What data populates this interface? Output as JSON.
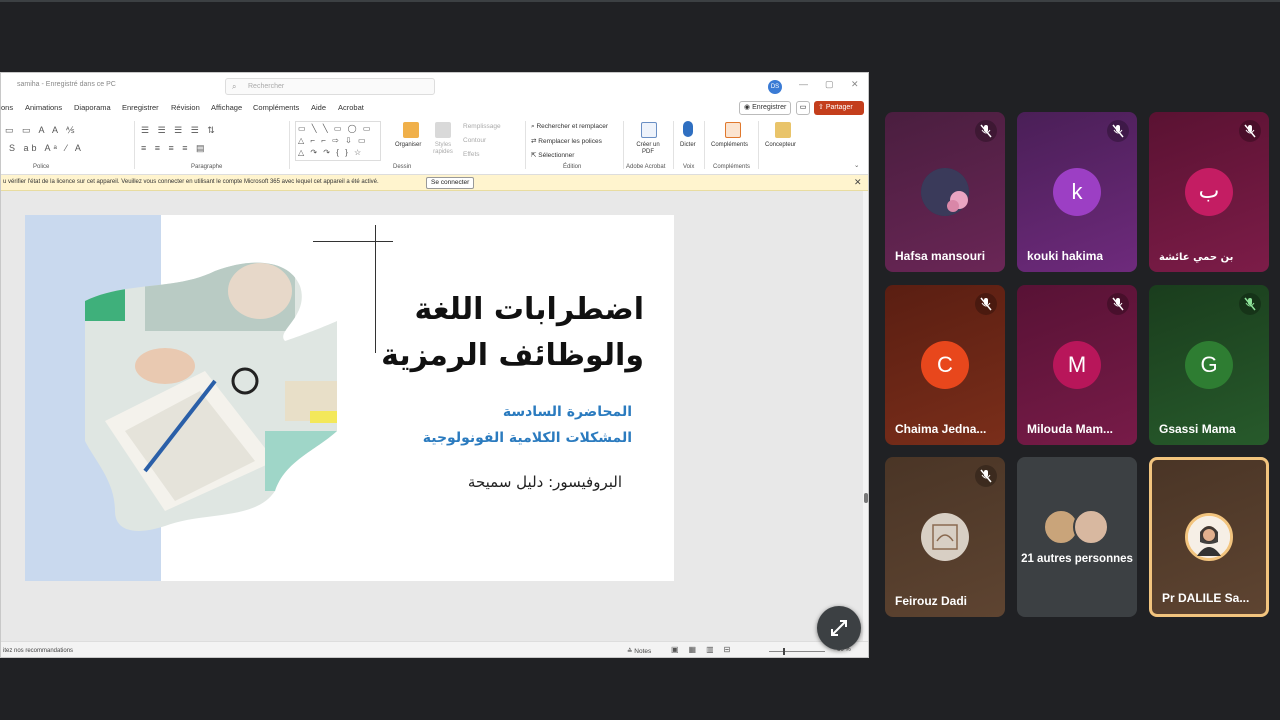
{
  "window": {
    "doc_title": "samiha - Enregistré dans ce PC",
    "search_placeholder": "Rechercher",
    "avatar_initials": "DS",
    "minimize": "—",
    "maximize": "▢",
    "close": "✕"
  },
  "menu": {
    "items": [
      "ons",
      "Animations",
      "Diaporama",
      "Enregistrer",
      "Révision",
      "Affichage",
      "Compléments",
      "Aide",
      "Acrobat"
    ],
    "save_label": "Enregistrer",
    "share_label": "Partager"
  },
  "ribbon": {
    "groups": {
      "police": "Police",
      "paragraphe": "Paragraphe",
      "dessin": "Dessin",
      "edition": "Édition",
      "adobe": "Adobe Acrobat",
      "voix": "Voix",
      "complements": "Compléments"
    },
    "tools": {
      "organiser": "Organiser",
      "styles": "Styles rapides",
      "remplissage": "Remplissage",
      "contour": "Contour",
      "effets": "Effets",
      "rechercher": "Rechercher et remplacer",
      "remplacer_polices": "Remplacer les polices",
      "selectionner": "Sélectionner",
      "creer_pdf": "Créer un PDF",
      "dicter": "Dicter",
      "complements": "Compléments",
      "concepteur": "Concepteur"
    }
  },
  "infobar": {
    "message": "u vérifier l'état de la licence sur cet appareil. Veuillez vous connecter en utilisant le compte Microsoft 365 avec lequel cet appareil a été activé.",
    "connect_label": "Se connecter",
    "close": "✕"
  },
  "slide": {
    "title_line1": "اضطرابات اللغة",
    "title_line2": "والوظائف الرمزية",
    "subtitle_line1": "المحاضرة السادسة",
    "subtitle_line2": "المشكلات الكلامية الفونولوجية",
    "author": "البروفيسور: دليل سميحة"
  },
  "status": {
    "left_text": "itez nos recommandations",
    "notes_label": "Notes",
    "zoom": "60 %"
  },
  "participants": [
    {
      "name": "Hafsa mansouri",
      "initial": "",
      "muted": true,
      "bg": "#5a2146"
    },
    {
      "name": "kouki hakima",
      "initial": "k",
      "muted": true,
      "bg": "#5d2069"
    },
    {
      "name": "بن حمي عائشة",
      "initial": "ب",
      "muted": true,
      "bg": "#6b1540"
    },
    {
      "name": "Chaima Jedna...",
      "initial": "C",
      "muted": true,
      "bg": "#6a2417"
    },
    {
      "name": "Milouda Mam...",
      "initial": "M",
      "muted": true,
      "bg": "#65143a"
    },
    {
      "name": "Gsassi Mama",
      "initial": "G",
      "muted": true,
      "bg": "#1f4722"
    },
    {
      "name": "Feirouz Dadi",
      "initial": "",
      "muted": true,
      "bg": "#4f3a2a"
    },
    {
      "name": "21 autres personnes",
      "initial": "",
      "muted": false,
      "bg": "#3c4043"
    },
    {
      "name": "Pr DALILE Sa...",
      "initial": "",
      "muted": false,
      "bg": "#4f3a2a"
    }
  ],
  "colors": {
    "meet_bg": "#202124",
    "share_button": "#c43e1c",
    "subtitle_blue": "#2b7bbf",
    "active_speaker_border": "#f2c47e"
  }
}
